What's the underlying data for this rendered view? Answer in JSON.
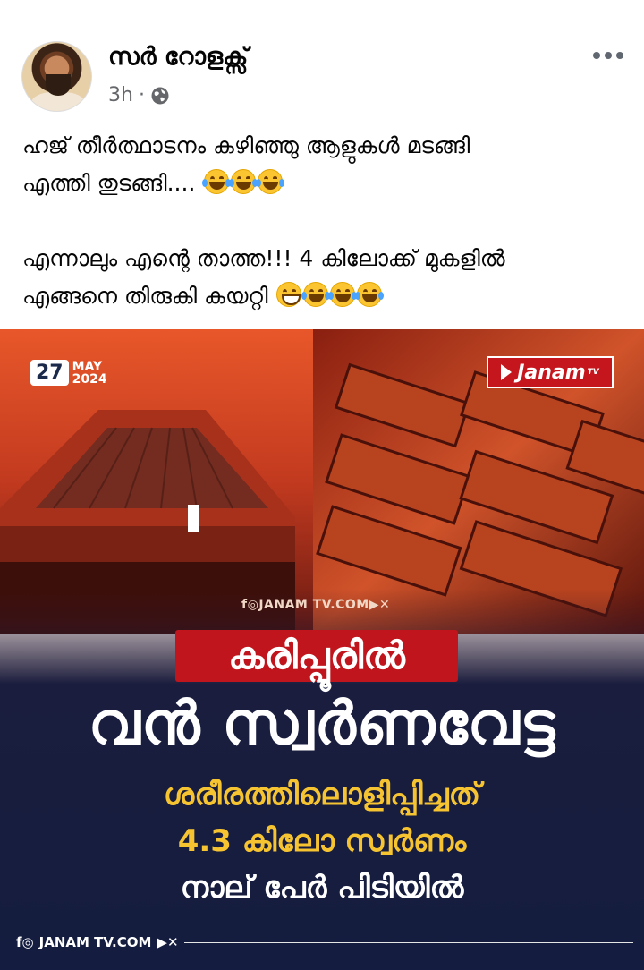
{
  "post": {
    "author": "സർ റോളക്സ്",
    "time": "3h",
    "separator": "·",
    "audience_icon": "globe-icon",
    "more_icon": "more-options-icon",
    "caption": {
      "line1": "ഹജ് തീർത്ഥാടനം കഴിഞ്ഞു ആളുകൾ മടങ്ങി",
      "line2": "എത്തി തുടങ്ങി....",
      "line3": "എന്നാലും എന്റെ താത്ത!!! 4 കിലോക്ക് മുകളിൽ",
      "line4": "എങ്ങനെ തിരുകി കയറ്റി"
    }
  },
  "news_image": {
    "date_day": "27",
    "date_month": "MAY",
    "date_year": "2024",
    "logo_text": "Janam",
    "logo_suffix": "TV",
    "watermark": "JANAM TV.COM",
    "headline_box": "കരിപ്പൂരിൽ",
    "headline_main": "വൻ സ്വർണവേട്ട",
    "sub1": "ശരീരത്തിലൊളിപ്പിച്ചത്",
    "sub2": "4.3 കിലോ സ്വർണം",
    "sub3": "നാല് പേർ പിടിയിൽ",
    "footer": "JANAM TV.COM",
    "colors": {
      "headline_red": "#c0151c",
      "sub_gold": "#f7c431",
      "navy": "#141d3f"
    }
  }
}
